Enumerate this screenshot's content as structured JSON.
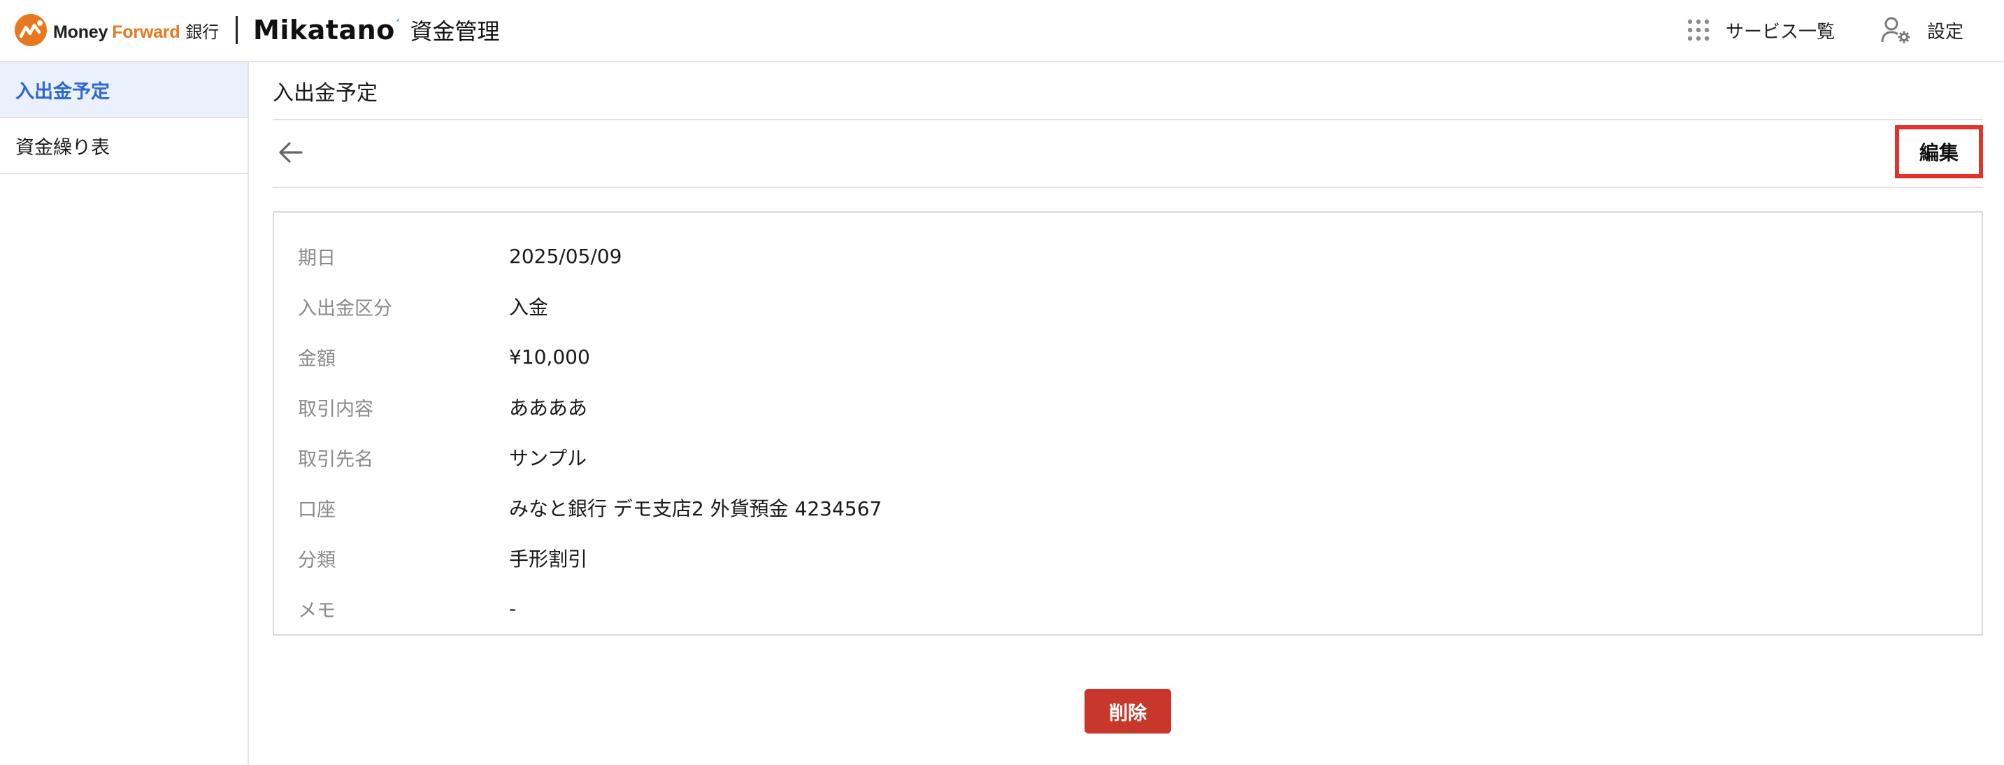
{
  "header": {
    "brand_money": "Money",
    "brand_forward": "Forward",
    "brand_bank": "銀行",
    "product_logo": "Mikatano",
    "product_name": "資金管理",
    "services_label": "サービス一覧",
    "settings_label": "設定"
  },
  "sidebar": {
    "items": [
      {
        "label": "入出金予定",
        "active": true
      },
      {
        "label": "資金繰り表",
        "active": false
      }
    ]
  },
  "main": {
    "page_title": "入出金予定",
    "edit_label": "編集",
    "delete_label": "削除",
    "fields": [
      {
        "label": "期日",
        "value": "2025/05/09"
      },
      {
        "label": "入出金区分",
        "value": "入金"
      },
      {
        "label": "金額",
        "value": "¥10,000"
      },
      {
        "label": "取引内容",
        "value": "ああああ"
      },
      {
        "label": "取引先名",
        "value": "サンプル"
      },
      {
        "label": "口座",
        "value": "みなと銀行 デモ支店2 外貨預金 4234567"
      },
      {
        "label": "分類",
        "value": "手形割引"
      },
      {
        "label": "メモ",
        "value": "-"
      }
    ]
  },
  "colors": {
    "accent": "#2c67d6",
    "active_bg": "#eaf1fd",
    "danger": "#c9372c",
    "highlight": "#e3322a",
    "brand_orange": "#e8771e"
  },
  "icons": {
    "back": "arrow-left-icon",
    "services": "grid-dots-icon",
    "settings": "user-gear-icon"
  }
}
